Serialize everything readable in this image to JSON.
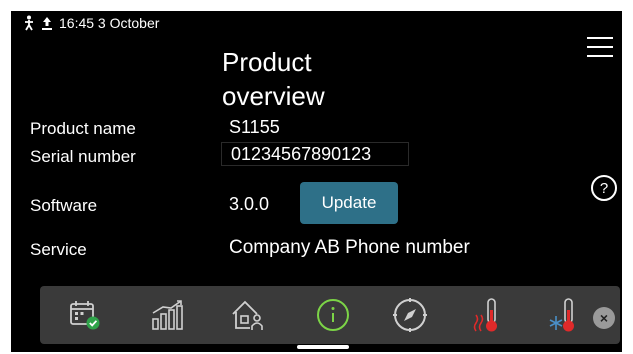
{
  "status": {
    "time_date": "16:45 3 October",
    "icons": [
      "person-icon",
      "upload-icon"
    ]
  },
  "page": {
    "title": "Product overview"
  },
  "product": {
    "name_label": "Product name",
    "name_value": "S1155",
    "serial_label": "Serial number",
    "serial_value": "01234567890123",
    "software_label": "Software",
    "software_value": "3.0.0",
    "update_label": "Update",
    "service_label": "Service",
    "service_value": "Company AB Phone number"
  },
  "help": {
    "symbol": "?"
  },
  "navbar": {
    "items": [
      "calendar-check-icon",
      "statistics-icon",
      "house-person-icon",
      "info-icon",
      "compass-icon",
      "heat-thermometer-icon",
      "cool-thermometer-icon"
    ],
    "selected": "info-icon",
    "close_symbol": "×"
  },
  "colors": {
    "accent": "#2e7088",
    "heat": "#e02a2a",
    "cool": "#4a8fc7",
    "check": "#2fa34a"
  }
}
